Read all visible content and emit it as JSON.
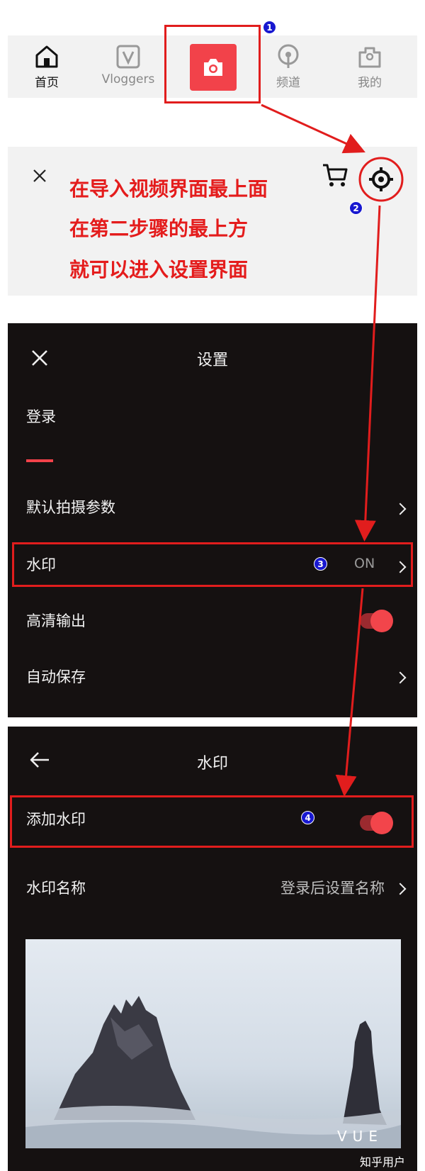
{
  "tabbar": {
    "tabs": [
      {
        "label": "首页",
        "icon": "home-icon"
      },
      {
        "label": "Vloggers",
        "icon": "vloggers-icon"
      },
      {
        "label": "",
        "icon": "camera-icon"
      },
      {
        "label": "频道",
        "icon": "channel-icon"
      },
      {
        "label": "我的",
        "icon": "profile-icon"
      }
    ]
  },
  "badges": {
    "b1": "1",
    "b2": "2",
    "b3": "3",
    "b4": "4"
  },
  "instruction": {
    "lines": [
      "在导入视频界面最上面",
      "在第二步骤的最上方",
      "就可以进入设置界面"
    ]
  },
  "settings": {
    "title": "设置",
    "login": "登录",
    "items": [
      {
        "label": "默认拍摄参数"
      },
      {
        "label": "水印",
        "value": "ON"
      },
      {
        "label": "高清输出"
      },
      {
        "label": "自动保存"
      }
    ]
  },
  "watermark": {
    "title": "水印",
    "add_label": "添加水印",
    "name_label": "水印名称",
    "name_value": "登录后设置名称"
  },
  "photo_mark": "VUE",
  "footer_mark": "知乎用户",
  "colors": {
    "accent": "#f2424a",
    "highlight": "#e11d1d",
    "dark_bg": "#151111",
    "badge": "#1818d0"
  }
}
